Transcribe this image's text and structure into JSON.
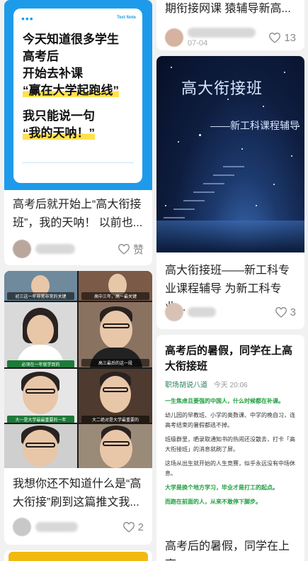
{
  "left_column": {
    "card_quote": {
      "image": {
        "tag": "Text Note",
        "lines": [
          "今天知道很多学生",
          "高考后",
          "开始去补课",
          "“赢在大学起跑线”",
          "",
          "我只能说一句",
          "“我的天呐！”"
        ]
      },
      "title": "高考后就开始上“高大衔接班”，我的天呐！ 以前也...",
      "likes_label": "赞"
    },
    "card_video": {
      "captions": [
        "初三这一年非常非常的关键",
        "高中三年，高一最关键",
        "必须在一年就学到的",
        "高三最后的这一段",
        "大一是大学最最重要的一年",
        "大二绝对是大学最重要的"
      ],
      "title": "我想你还不知道什么是“高大衔接”刷到这篇推文我...",
      "likes": "2"
    },
    "card_peek": {}
  },
  "right_column": {
    "card_top_partial": {
      "title": "期衔接网课 猿辅导新高...",
      "date": "07-04",
      "likes": "13"
    },
    "card_starry": {
      "image": {
        "title": "高大衔接班",
        "subtitle": "——新工科课程辅导"
      },
      "title": "高大衔接班——新工科专业课程辅导 为新工科专业...",
      "likes": "3"
    },
    "card_article": {
      "headline": "高考后的暑假，同学在上高大衔接班",
      "source": "职场胡说八道",
      "time": "今天 20:06",
      "paragraphs": [
        "一生焦虑且要强的中国人，什么时候都在补课。",
        "幼儿园的早教班、小学的奥数课、中学的晚自习，连高考结束的暑假都逃不掉。",
        "班级群里，晒录取通知书的热闹还没散去，打卡「高大衔接班」的消息就刷了屏。",
        "这场从出生就开始的人生竞赛，似乎永远没有中场休息。",
        "大学是换个地方学习，毕业才是打工的起点。",
        "而跑在前面的人，从来不敢停下脚步。"
      ]
    },
    "card_bottom_partial": {
      "title": "高考后的暑假，同学在上高"
    }
  },
  "colors": {
    "page_bg": "#f1f1f1",
    "note_blue": "#1d9bea",
    "highlight_yellow": "#ffe14d",
    "green_text": "#1e9e3e",
    "source_green": "#2b7f5e"
  },
  "icons": [
    "heart-icon"
  ]
}
